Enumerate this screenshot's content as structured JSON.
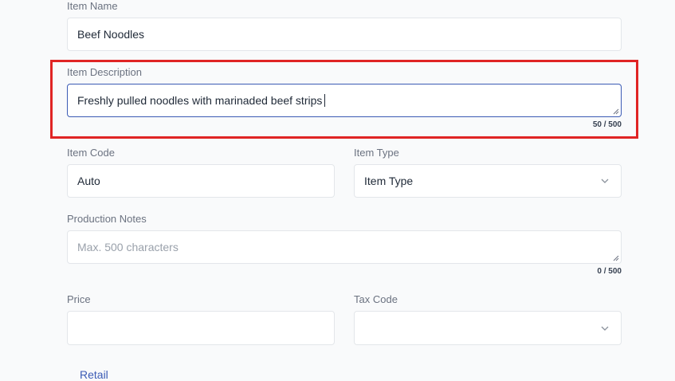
{
  "form": {
    "item_name": {
      "label": "Item Name",
      "value": "Beef Noodles"
    },
    "item_description": {
      "label": "Item Description",
      "value": "Freshly pulled noodles with marinaded beef strips",
      "counter": "50 / 500"
    },
    "item_code": {
      "label": "Item Code",
      "value": "Auto"
    },
    "item_type": {
      "label": "Item Type",
      "value": "Item Type"
    },
    "production_notes": {
      "label": "Production Notes",
      "placeholder": "Max. 500 characters",
      "counter": "0 / 500"
    },
    "price": {
      "label": "Price",
      "value": ""
    },
    "tax_code": {
      "label": "Tax Code",
      "value": ""
    }
  },
  "footer": {
    "link_label": "Retail"
  },
  "colors": {
    "highlight": "#e02424",
    "focus_border": "#3b5bb5"
  },
  "icons": {
    "select_arrow": "chevron-down-icon",
    "resize_handle": "resize-handle-icon"
  }
}
